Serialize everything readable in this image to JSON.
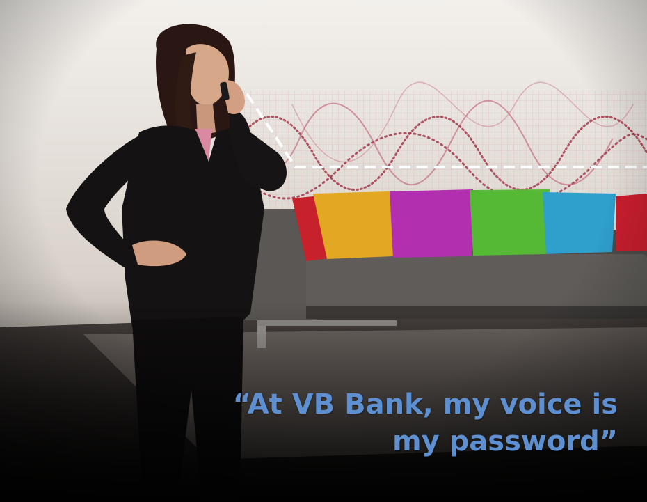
{
  "scene": {
    "description_icons": [
      "woman-on-phone",
      "sofa",
      "cushions",
      "sound-wave-graphic"
    ],
    "cushion_colors": [
      "#c7222b",
      "#e3a823",
      "#b22fb0",
      "#55b935",
      "#2f9fcc",
      "#c91e2e"
    ],
    "accent": "#5e8fd0"
  },
  "quote": {
    "line1": "“At VB Bank, my voice is",
    "line2": "my password”"
  }
}
